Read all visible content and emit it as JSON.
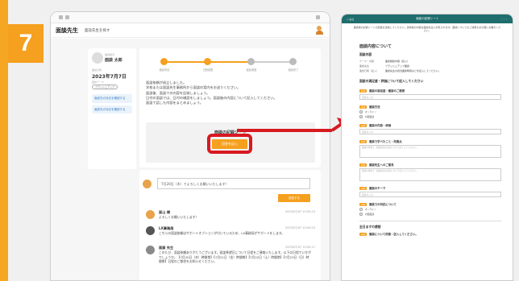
{
  "step": {
    "number": "7"
  },
  "left_screen": {
    "header_title": "面談先生",
    "header_sub": "面談先生を探す",
    "info": {
      "label1": "面談相手",
      "name": "面談 太郎",
      "label2": "面談日時",
      "date": "2023年7月7日",
      "label3": "面談テーマ",
      "theme": "ブラッシュアップ",
      "link1": "面談先の対応を確認する",
      "link2": "面談先の対応を確認する"
    },
    "progress_steps": [
      "面談申請",
      "日程調整",
      "面談実施",
      "面談終了"
    ],
    "main_text": [
      "面談依頼が成立しました。",
      "学校または面談先生事務所から面談の案内をお送りください。",
      "面談後、面談での内容を記録しましょう。",
      "日付の面談では、日付の確認をしましょう。面談後の内容について記入してください。",
      "面談で話した内容をまとめましょう。"
    ],
    "report_label": "面談の記録シート",
    "report_button": "回答を記入",
    "message_input": "7月20日（木）でよろしくお願いいたします！",
    "send_button": "送信する",
    "chats": [
      {
        "name": "面山 様",
        "time": "2023/07/07 15:50:23",
        "text": "よろしくお願いいたします！"
      },
      {
        "name": "LX事務局",
        "time": "2023/07/07 15:50:23",
        "text": "こちらの面談依頼はサポートオプションが付いているため、LX事務局がサポートをします。"
      },
      {
        "name": "面談 先生",
        "time": "2023/07/07 15:50:17",
        "text": "このたび、面談依頼ありがとうございます。面談希望日について日程をご連絡いたします。以下の日程でいかがでしょうか。【7月20日（木）時間帯】【7月21日（金）時間帯】【7月22日（土）時間帯】【7月23日（日）時間帯】日程のご都合をお知らせください。"
      }
    ]
  },
  "right_screen": {
    "top_left": "< 戻る",
    "top_title": "面談の記録シート",
    "top_right": "・・・",
    "notice": "面談後の記録シートの回答を送信してください。送信後の内容は面談先生に共有されます。面談についてのご感想もお気軽にお書きください。",
    "section_title": "面談内容について",
    "sub_title": "面談内容",
    "fields": [
      {
        "k": "テーマ・内容",
        "v": "面談相談内容（記入）"
      },
      {
        "k": "面談先生",
        "v": "ブラッシュアップ面談"
      },
      {
        "k": "面談日時（記入）",
        "v": "面談先生の担当面談時間などを記入してください。"
      }
    ],
    "q1_title": "面談の満足度・評価について記入してください",
    "questions": [
      {
        "badge": "必須",
        "title": "面談の満足度・面談のご感想"
      },
      {
        "badge": "必須",
        "title": "面談方法"
      },
      {
        "badge": "必須",
        "title": "面談の内容・評価"
      },
      {
        "badge": "任意",
        "title": "面談で学べたこと・改善点"
      },
      {
        "badge": "任意",
        "title": "面談先生へのご意見"
      },
      {
        "badge": "必須",
        "title": "面談のテーマ"
      },
      {
        "badge": "必須",
        "title": "面談での対応について"
      }
    ],
    "radios": [
      "オンライン",
      "対面面談"
    ],
    "placeholder": "回答を入力",
    "textarea_text": "面談の内容で、面談先生の対応について記入してください。",
    "bottom_section": "全日ますの感想",
    "bottom_q": "面談について改善・記入してください。"
  }
}
